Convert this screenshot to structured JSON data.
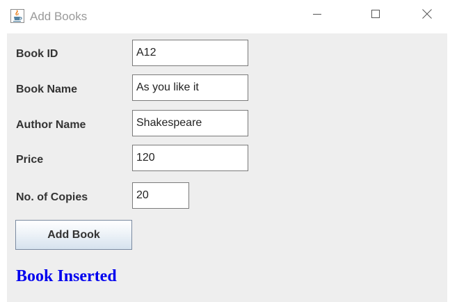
{
  "window": {
    "title": "Add Books",
    "app_icon": "java-cup-icon",
    "controls": {
      "minimize": "minimize-icon",
      "maximize": "maximize-icon",
      "close": "close-icon"
    }
  },
  "form": {
    "book_id": {
      "label": "Book ID",
      "value": "A12"
    },
    "book_name": {
      "label": "Book Name",
      "value": "As you like it"
    },
    "author_name": {
      "label": "Author Name",
      "value": "Shakespeare"
    },
    "price": {
      "label": "Price",
      "value": "120"
    },
    "copies": {
      "label": "No. of Copies",
      "value": "20"
    }
  },
  "actions": {
    "add_book_label": "Add Book"
  },
  "status": {
    "message": "Book Inserted",
    "color": "#0000ee"
  }
}
